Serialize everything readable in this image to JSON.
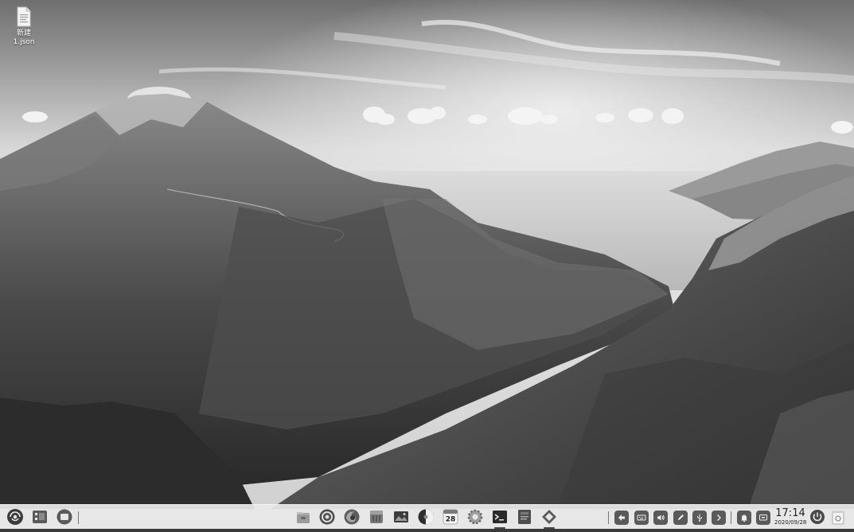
{
  "desktop": {
    "icons": [
      {
        "label": "新建\n1.json",
        "icon": "json-file-icon"
      }
    ]
  },
  "dock": {
    "left": [
      {
        "name": "launcher-button",
        "icon": "deepin-logo-icon"
      },
      {
        "name": "multitasking-view-button",
        "icon": "multitasking-view-icon"
      },
      {
        "name": "show-desktop-button",
        "icon": "show-desktop-icon"
      }
    ],
    "apps": [
      {
        "name": "dock-app-file-manager",
        "icon": "file-manager-icon"
      },
      {
        "name": "dock-app-browser",
        "icon": "browser-icon"
      },
      {
        "name": "dock-app-firefox",
        "icon": "firefox-icon"
      },
      {
        "name": "dock-app-app-store",
        "icon": "app-store-icon"
      },
      {
        "name": "dock-app-image-viewer",
        "icon": "image-viewer-icon"
      },
      {
        "name": "dock-app-music",
        "icon": "music-icon"
      },
      {
        "name": "dock-app-calendar",
        "icon": "calendar-icon",
        "day": "28"
      },
      {
        "name": "dock-app-settings",
        "icon": "settings-icon"
      },
      {
        "name": "dock-app-terminal",
        "icon": "terminal-icon",
        "running": true
      },
      {
        "name": "dock-app-text-editor",
        "icon": "text-editor-icon"
      },
      {
        "name": "dock-app-code-editor",
        "icon": "code-editor-icon",
        "running": true
      }
    ],
    "tray": [
      {
        "name": "tray-input-method",
        "icon": "input-method-icon"
      },
      {
        "name": "tray-keyboard",
        "icon": "keyboard-icon"
      },
      {
        "name": "tray-volume",
        "icon": "volume-icon"
      },
      {
        "name": "tray-pen",
        "icon": "pen-icon"
      },
      {
        "name": "tray-usb",
        "icon": "usb-icon"
      },
      {
        "name": "tray-expand",
        "icon": "chevron-right-icon"
      },
      {
        "name": "tray-notification",
        "icon": "bell-icon"
      },
      {
        "name": "tray-screen",
        "icon": "screen-icon"
      }
    ],
    "clock": {
      "time": "17:14",
      "date": "2020/09/28"
    },
    "right": [
      {
        "name": "power-button",
        "icon": "power-icon"
      },
      {
        "name": "trash-button",
        "icon": "trash-icon"
      }
    ]
  },
  "colors": {
    "dock_background": "#e8e8e8",
    "tray_button": "#5a5a5a",
    "wallpaper_sky": "#d8d8d8",
    "wallpaper_mountain": "#3a3a3a"
  }
}
